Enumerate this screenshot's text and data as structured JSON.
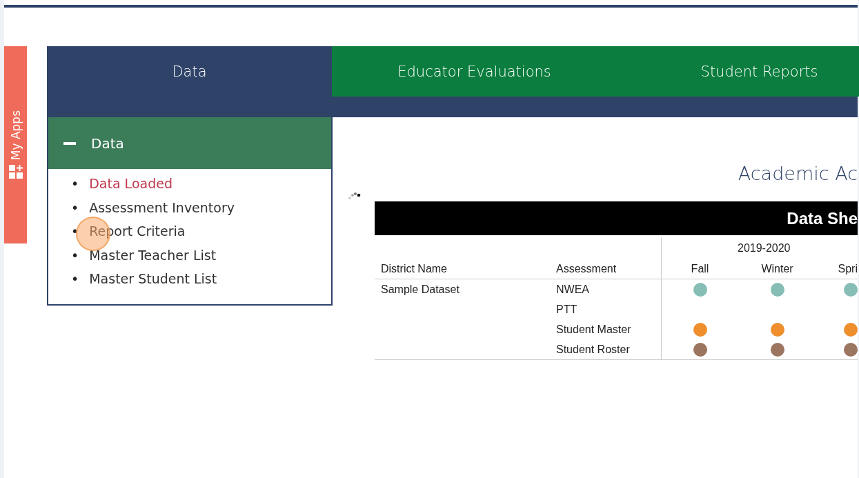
{
  "my_apps_tab": {
    "label": "My Apps"
  },
  "tabs": [
    {
      "label": "Data",
      "selected": true
    },
    {
      "label": "Educator Evaluations",
      "selected": false
    },
    {
      "label": "Student Reports",
      "selected": false
    }
  ],
  "sidebar": {
    "title": "Data",
    "expanded": true,
    "items": [
      {
        "bullet": "•",
        "label": "Data Loaded",
        "selected": true
      },
      {
        "bullet": "•",
        "label": "Assessment Inventory",
        "selected": false
      },
      {
        "bullet": "•",
        "label": "Report Criteria",
        "selected": false
      },
      {
        "bullet": "•",
        "label": "Master Teacher List",
        "selected": false
      },
      {
        "bullet": "•",
        "label": "Master Student List",
        "selected": false
      }
    ]
  },
  "content": {
    "title": "Academic Ac",
    "table": {
      "banner": "Data She",
      "year": "2019-2020",
      "columns": [
        "District Name",
        "Assessment",
        "Fall",
        "Winter",
        "Spri"
      ],
      "rows": [
        {
          "district": "Sample Dataset",
          "assessment": "NWEA",
          "cells": [
            {
              "color": "#86bdb5"
            },
            {
              "color": "#86bdb5"
            },
            {
              "color": "#86bdb5"
            }
          ]
        },
        {
          "assessment": "PTT",
          "cells": []
        },
        {
          "assessment": "Student Master",
          "cells": [
            {
              "color": "#ee8e2d"
            },
            {
              "color": "#ee8e2d"
            },
            {
              "color": "#ee8e2d"
            }
          ]
        },
        {
          "assessment": "Student Roster",
          "cells": [
            {
              "color": "#9b7560"
            },
            {
              "color": "#9b7560"
            },
            {
              "color": "#9b7560"
            }
          ]
        }
      ]
    }
  }
}
